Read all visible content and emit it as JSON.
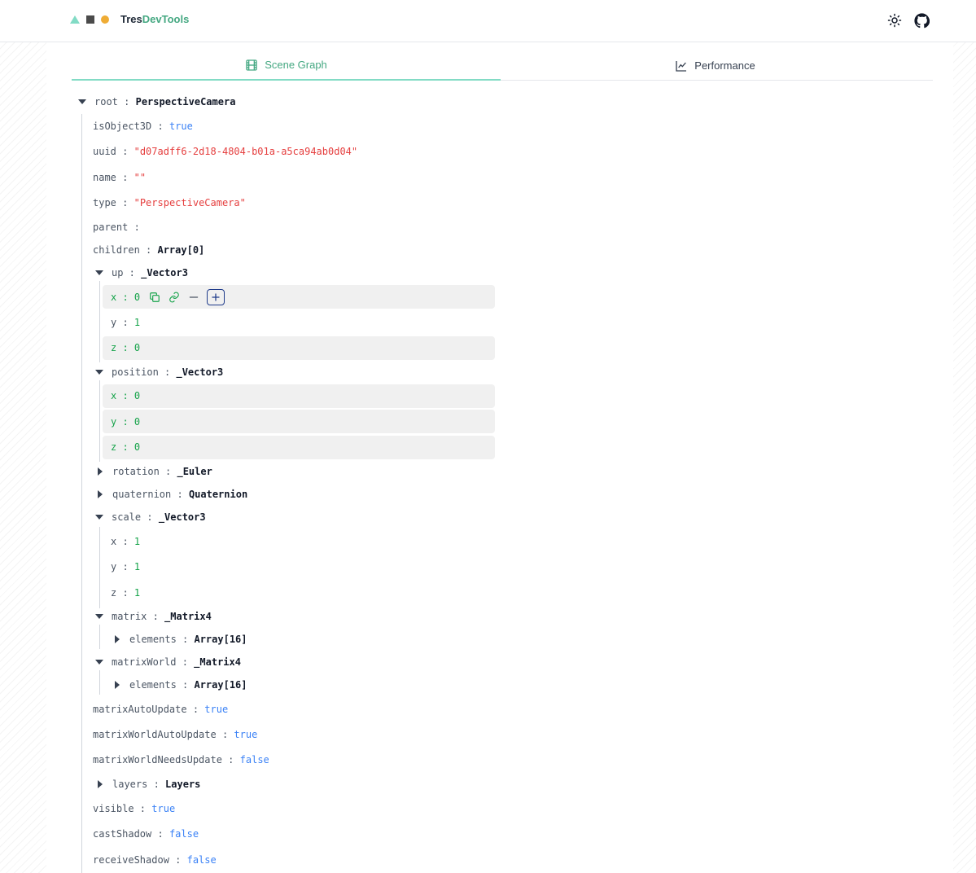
{
  "header": {
    "brand_a": "Tres",
    "brand_b": "DevTools",
    "theme_icon": "sun-icon",
    "github_icon": "github-icon",
    "colors": {
      "triangle": "#82dbc5",
      "square": "#4b4b4b",
      "dot": "#efac35",
      "brand_accent": "#45a882"
    }
  },
  "tabs": [
    {
      "label": "Scene Graph",
      "icon": "film-icon",
      "active": true
    },
    {
      "label": "Performance",
      "icon": "chart-line-icon",
      "active": false
    }
  ],
  "tree": {
    "root": {
      "key": "root",
      "sep": " : ",
      "value": "PerspectiveCamera"
    },
    "isObject3D": {
      "key": "isObject3D",
      "sep": " : ",
      "value": "true"
    },
    "uuid": {
      "key": "uuid",
      "sep": " : ",
      "value": "\"d07adff6-2d18-4804-b01a-a5ca94ab0d04\""
    },
    "name": {
      "key": "name",
      "sep": " : ",
      "value": "\"\""
    },
    "type": {
      "key": "type",
      "sep": " : ",
      "value": "\"PerspectiveCamera\""
    },
    "parent": {
      "key": "parent",
      "sep": " :",
      "value": ""
    },
    "children": {
      "key": "children",
      "sep": " : ",
      "value": "Array[0]"
    },
    "up": {
      "key": "up",
      "sep": " : ",
      "value": "_Vector3",
      "x": {
        "key": "x",
        "sep": " : ",
        "value": "0"
      },
      "y": {
        "key": "y",
        "sep": " : ",
        "value": "1"
      },
      "z": {
        "key": "z",
        "sep": " : ",
        "value": "0"
      }
    },
    "position": {
      "key": "position",
      "sep": " : ",
      "value": "_Vector3",
      "x": {
        "key": "x",
        "sep": " : ",
        "value": "0"
      },
      "y": {
        "key": "y",
        "sep": " : ",
        "value": "0"
      },
      "z": {
        "key": "z",
        "sep": " : ",
        "value": "0"
      }
    },
    "rotation": {
      "key": "rotation",
      "sep": " : ",
      "value": "_Euler"
    },
    "quaternion": {
      "key": "quaternion",
      "sep": " : ",
      "value": "Quaternion"
    },
    "scale": {
      "key": "scale",
      "sep": " : ",
      "value": "_Vector3",
      "x": {
        "key": "x",
        "sep": " : ",
        "value": "1"
      },
      "y": {
        "key": "y",
        "sep": " : ",
        "value": "1"
      },
      "z": {
        "key": "z",
        "sep": " : ",
        "value": "1"
      }
    },
    "matrix": {
      "key": "matrix",
      "sep": " : ",
      "value": "_Matrix4",
      "elements": {
        "key": "elements",
        "sep": " : ",
        "value": "Array[16]"
      }
    },
    "matrixWorld": {
      "key": "matrixWorld",
      "sep": " : ",
      "value": "_Matrix4",
      "elements": {
        "key": "elements",
        "sep": " : ",
        "value": "Array[16]"
      }
    },
    "matrixAutoUpdate": {
      "key": "matrixAutoUpdate",
      "sep": " : ",
      "value": "true"
    },
    "matrixWorldAutoUpdate": {
      "key": "matrixWorldAutoUpdate",
      "sep": " : ",
      "value": "true"
    },
    "matrixWorldNeedsUpdate": {
      "key": "matrixWorldNeedsUpdate",
      "sep": " : ",
      "value": "false"
    },
    "layers": {
      "key": "layers",
      "sep": " : ",
      "value": "Layers"
    },
    "visible": {
      "key": "visible",
      "sep": " : ",
      "value": "true"
    },
    "castShadow": {
      "key": "castShadow",
      "sep": " : ",
      "value": "false"
    },
    "receiveShadow": {
      "key": "receiveShadow",
      "sep": " : ",
      "value": "false"
    }
  },
  "row_actions": [
    "copy-icon",
    "link-icon",
    "minus-icon",
    "plus-icon"
  ]
}
